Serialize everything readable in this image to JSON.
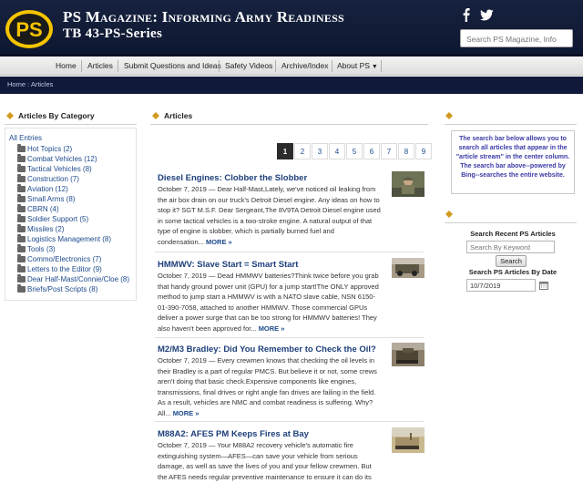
{
  "header": {
    "logo_text": "PS",
    "title_line1": "PS Magazine: Informing Army Readiness",
    "title_line2": "TB 43-PS-Series",
    "social": [
      "facebook-icon",
      "twitter-icon"
    ],
    "search_placeholder": "Search PS Magazine, Info"
  },
  "nav": {
    "items": [
      {
        "label": "Home"
      },
      {
        "label": "Articles"
      },
      {
        "label": "Submit Questions and Ideas"
      },
      {
        "label": "Safety Videos"
      },
      {
        "label": "Archive/Index"
      },
      {
        "label": "About PS"
      }
    ]
  },
  "breadcrumb": "Home : Articles",
  "left": {
    "heading": "Articles By Category",
    "all_entries": "All Entries",
    "categories": [
      "Hot Topics (2)",
      "Combat Vehicles (12)",
      "Tactical Vehicles (8)",
      "Construction (7)",
      "Aviation (12)",
      "Small Arms (8)",
      "CBRN (4)",
      "Soldier Support (5)",
      "Missiles (2)",
      "Logistics Management (8)",
      "Tools (3)",
      "Commo/Electronics (7)",
      "Letters to the Editor (9)",
      "Dear Half-Mast/Connie/Cloe (8)",
      "Briefs/Post Scripts (8)"
    ]
  },
  "center": {
    "heading": "Articles",
    "pages": [
      "1",
      "2",
      "3",
      "4",
      "5",
      "6",
      "7",
      "8",
      "9"
    ],
    "active_page": "1",
    "more_label": "MORE »",
    "articles": [
      {
        "title": "Diesel Engines: Clobber the Slobber",
        "body": "October 7, 2019 — Dear Half-Mast,Lately, we've noticed oil leaking from the air box drain on our truck's Detroit Diesel engine. Any ideas on how to stop it? SGT M.S.F. Dear Sergeant,The 8V9TA Detroit Diesel engine used in some tactical vehicles is a two-stroke engine. A natural output of that type of engine is slobber, which is partially burned fuel and condensation..."
      },
      {
        "title": "HMMWV: Slave Start = Smart Start",
        "body": "October 7, 2019 — Dead HMMWV batteries?Think twice before you grab that handy ground power unit (GPU) for a jump start!The ONLY approved method to jump start a HMMWV is with a NATO slave cable, NSN 6150-01-390-7058, attached to another HMMWV. Those commercial GPUs deliver a power surge that can be too strong for HMMWV batteries! They also haven't been approved for..."
      },
      {
        "title": "M2/M3 Bradley: Did You Remember to Check the Oil?",
        "body": "October 7, 2019 — Every crewmen knows that checking the oil levels in their Bradley is a part of regular PMCS. But believe it or not, some crews aren't doing that basic check.Expensive components like engines, transmissions, final drives or right angle fan drives are failing in the field. As a result, vehicles are NMC and combat readiness is suffering. Why? All..."
      },
      {
        "title": "M88A2: AFES PM Keeps Fires at Bay",
        "body": "October 7, 2019 — Your M88A2 recovery vehicle's automatic fire extinguishing system—AFES—can save your vehicle from serious damage, as well as save the lives of you and your fellow crewmen. But the AFES needs regular preventive maintenance to ensure it can do its"
      }
    ]
  },
  "right": {
    "info_text": "The search bar below allows you to search all articles that appear in the \"article stream\" in the center column. The search bar above--powered by Bing--searches the entire website.",
    "search_recent_label": "Search Recent PS Articles",
    "keyword_placeholder": "Search By Keyword",
    "search_button": "Search",
    "date_label": "Search PS Articles By Date",
    "date_value": "10/7/2019"
  },
  "colors": {
    "header_bg": "#17223f",
    "logo_gold": "#f5c400",
    "link_blue": "#1d4a8c",
    "title_blue": "#1d3f7a",
    "info_text": "#3a3aa6"
  }
}
